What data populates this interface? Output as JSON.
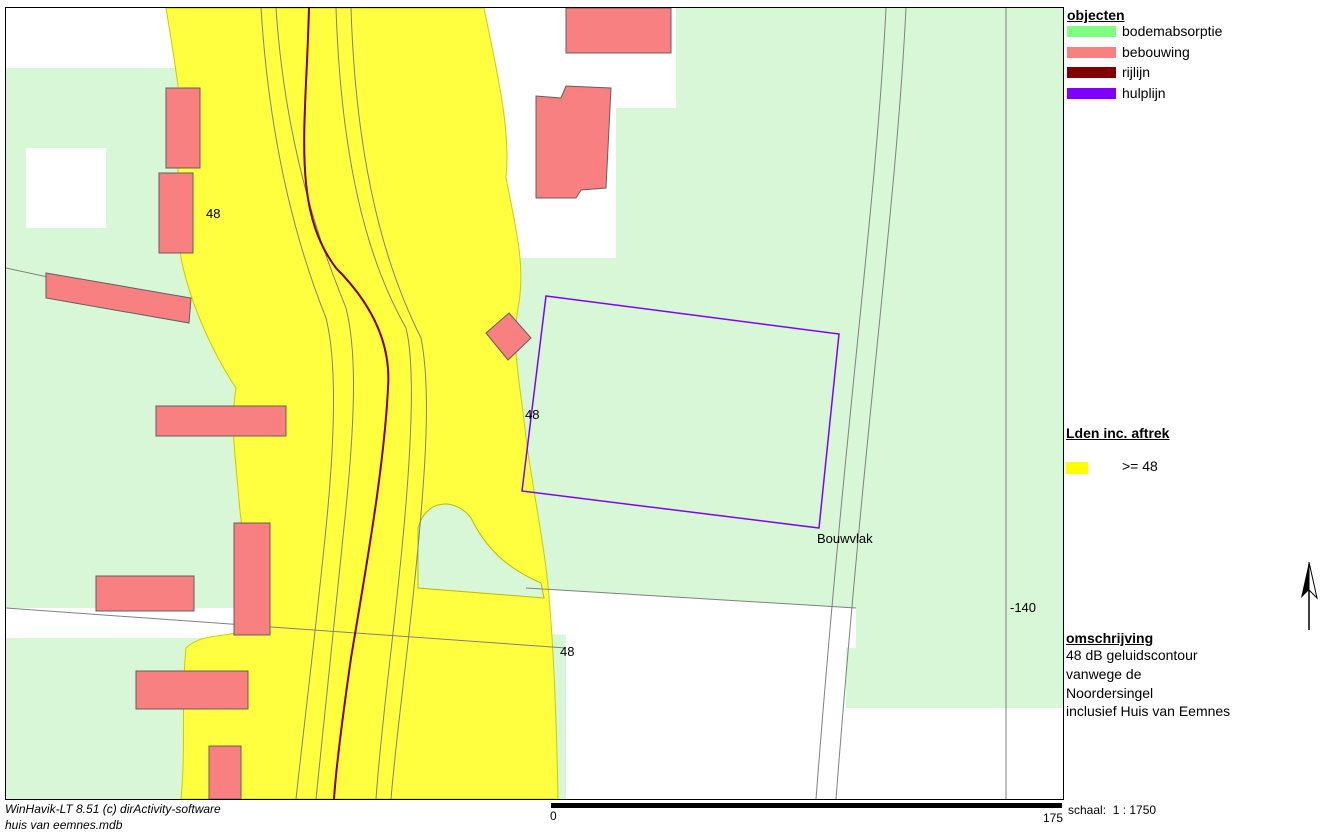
{
  "legend": {
    "objects_title": "objecten",
    "items": [
      {
        "label": "bodemabsorptie",
        "color": "#80ff80"
      },
      {
        "label": "bebouwing",
        "color": "#f88080"
      },
      {
        "label": "rijlijn",
        "color": "#800000"
      },
      {
        "label": "hulplijn",
        "color": "#8000ff"
      }
    ],
    "lden_title": "Lden inc. aftrek",
    "lden_item": {
      "label": ">= 48",
      "color": "#ffff00"
    }
  },
  "description": {
    "title": "omschrijving",
    "lines": [
      "48 dB geluidscontour",
      "vanwege de",
      "Noordersingel",
      "inclusief Huis van Eemnes"
    ]
  },
  "map": {
    "contour_labels": [
      "48",
      "48",
      "48"
    ],
    "building_plot_label": "Bouwvlak",
    "elevation_label": "-140"
  },
  "footer": {
    "software": "WinHavik-LT 8.51 (c) dirActivity-software",
    "database": "huis van eemnes.mdb",
    "scale_start": "0",
    "scale_end": "175",
    "scale_text": "schaal:  1 : 1750"
  },
  "colors": {
    "ground_absorption": "#d7f7d7",
    "contour_fill": "#ffff40",
    "building": "#f88080",
    "drive_line": "#800000",
    "aux_line": "#8000ff"
  }
}
